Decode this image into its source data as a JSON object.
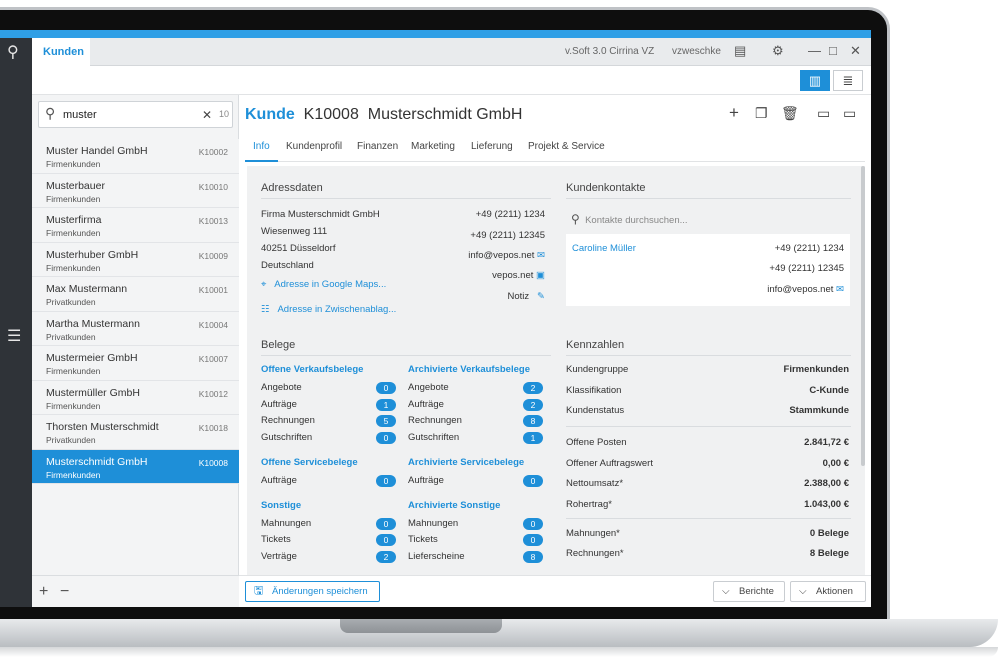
{
  "titlebar": {
    "tab": "Kunden",
    "version": "v.Soft 3.0 Cirrina VZ",
    "user": "vzweschke",
    "icons": [
      "chat-icon",
      "gear-icon",
      "minimize-icon",
      "maximize-icon",
      "close-icon"
    ]
  },
  "search": {
    "value": "muster",
    "count": "10"
  },
  "customers": [
    {
      "name": "Muster Handel GmbH",
      "type": "Firmenkunden",
      "id": "K10002"
    },
    {
      "name": "Musterbauer",
      "type": "Firmenkunden",
      "id": "K10010"
    },
    {
      "name": "Musterfirma",
      "type": "Firmenkunden",
      "id": "K10013"
    },
    {
      "name": "Musterhuber GmbH",
      "type": "Firmenkunden",
      "id": "K10009"
    },
    {
      "name": "Max Mustermann",
      "type": "Privatkunden",
      "id": "K10001"
    },
    {
      "name": "Martha Mustermann",
      "type": "Privatkunden",
      "id": "K10004"
    },
    {
      "name": "Mustermeier GmbH",
      "type": "Firmenkunden",
      "id": "K10007"
    },
    {
      "name": "Mustermüller GmbH",
      "type": "Firmenkunden",
      "id": "K10012"
    },
    {
      "name": "Thorsten Musterschmidt",
      "type": "Privatkunden",
      "id": "K10018"
    },
    {
      "name": "Musterschmidt GmbH",
      "type": "Firmenkunden",
      "id": "K10008"
    }
  ],
  "header": {
    "label": "Kunde",
    "id": "K10008",
    "name": "Musterschmidt GmbH"
  },
  "tabs": [
    "Info",
    "Kundenprofil",
    "Finanzen",
    "Marketing",
    "Lieferung",
    "Projekt & Service"
  ],
  "address": {
    "title": "Adressdaten",
    "lines": [
      "Firma Musterschmidt GmbH",
      "Wiesenweg 111",
      "40251 Düsseldorf",
      "Deutschland"
    ],
    "phone1": "+49 (2211) 1234",
    "phone2": "+49 (2211) 12345",
    "email": "info@vepos.net",
    "web": "vepos.net",
    "note": "Notiz",
    "maps": "Adresse in Google Maps...",
    "clipboard": "Adresse in Zwischenablag..."
  },
  "contacts": {
    "title": "Kundenkontakte",
    "placeholder": "Kontakte durchsuchen...",
    "name": "Caroline Müller",
    "phone1": "+49 (2211) 1234",
    "phone2": "+49 (2211) 12345",
    "email": "info@vepos.net"
  },
  "belege": {
    "title": "Belege",
    "col1": [
      {
        "section": "Offene Verkaufsbelege",
        "rows": [
          [
            "Angebote",
            "0"
          ],
          [
            "Aufträge",
            "1"
          ],
          [
            "Rechnungen",
            "5"
          ],
          [
            "Gutschriften",
            "0"
          ]
        ]
      },
      {
        "section": "Offene Servicebelege",
        "rows": [
          [
            "Aufträge",
            "0"
          ]
        ]
      },
      {
        "section": "Sonstige",
        "rows": [
          [
            "Mahnungen",
            "0"
          ],
          [
            "Tickets",
            "0"
          ],
          [
            "Verträge",
            "2"
          ]
        ]
      }
    ],
    "col2": [
      {
        "section": "Archivierte Verkaufsbelege",
        "rows": [
          [
            "Angebote",
            "2"
          ],
          [
            "Aufträge",
            "2"
          ],
          [
            "Rechnungen",
            "8"
          ],
          [
            "Gutschriften",
            "1"
          ]
        ]
      },
      {
        "section": "Archivierte Servicebelege",
        "rows": [
          [
            "Aufträge",
            "0"
          ]
        ]
      },
      {
        "section": "Archivierte Sonstige",
        "rows": [
          [
            "Mahnungen",
            "0"
          ],
          [
            "Tickets",
            "0"
          ],
          [
            "Lieferscheine",
            "8"
          ]
        ]
      }
    ]
  },
  "kennzahlen": {
    "title": "Kennzahlen",
    "groups": [
      [
        [
          "Kundengruppe",
          "Firmenkunden"
        ],
        [
          "Klassifikation",
          "C-Kunde"
        ],
        [
          "Kundenstatus",
          "Stammkunde"
        ]
      ],
      [
        [
          "Offene Posten",
          "2.841,72 €"
        ],
        [
          "Offener Auftragswert",
          "0,00 €"
        ],
        [
          "Nettoumsatz*",
          "2.388,00 €"
        ],
        [
          "Rohertrag*",
          "1.043,00 €"
        ]
      ],
      [
        [
          "Mahnungen*",
          "0 Belege"
        ],
        [
          "Rechnungen*",
          "8 Belege"
        ]
      ]
    ]
  },
  "footer": {
    "save": "Änderungen speichern",
    "reports": "Berichte",
    "actions": "Aktionen"
  }
}
